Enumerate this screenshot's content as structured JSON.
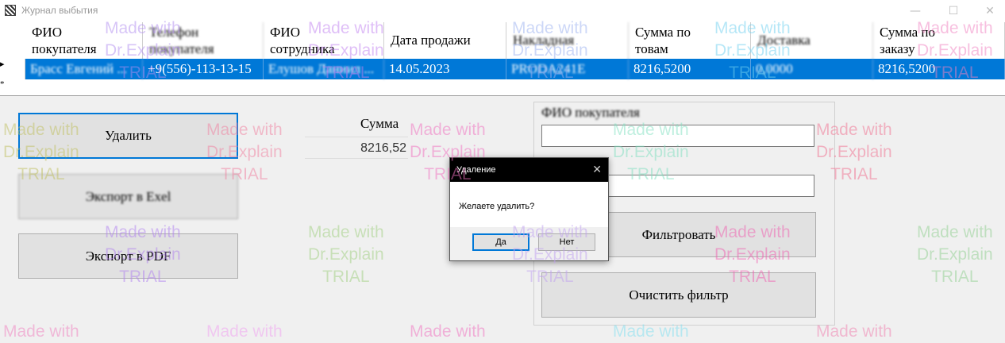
{
  "window": {
    "title": "Журнал выбытия",
    "min_glyph": "—",
    "max_glyph": "☐",
    "close_glyph": "✕"
  },
  "grid": {
    "columns": [
      "ФИО\nпокупателя",
      "Телефон\nпокупателя",
      "ФИО\nсотрудника",
      "Дата продажи",
      "Накладная",
      "Сумма по\nтовам",
      "Доставка",
      "Сумма по\nзаказу"
    ],
    "row": [
      "Брасс Евгений ...",
      "+9(556)-113-13-15",
      "Елушов Даниил ...",
      "14.05.2023",
      "PRODA241E",
      "8216,5200",
      "0,0000",
      "8216,5200"
    ],
    "row_indicator": "▸",
    "new_row_indicator": "*"
  },
  "buttons": {
    "delete": "Удалить",
    "export_excel": "Экспорт в Exel",
    "export_pdf": "Экспорт в PDF",
    "filter": "Фильтровать",
    "clear_filter": "Очистить фильтр"
  },
  "sum": {
    "label": "Сумма",
    "value": "8216,52"
  },
  "filter_panel": {
    "buyer_label": "ФИО покупателя",
    "buyer_value": "",
    "second_value": ""
  },
  "dialog": {
    "title": "Удаление",
    "close_glyph": "✕",
    "message": "Желаете удалить?",
    "yes": "Да",
    "no": "Нет"
  },
  "watermark": {
    "line1": "Made with",
    "line2": "Dr.Explain",
    "line3": "TRIAL"
  },
  "colors": {
    "selection": "#0078d7",
    "focus_border": "#0078d7"
  }
}
